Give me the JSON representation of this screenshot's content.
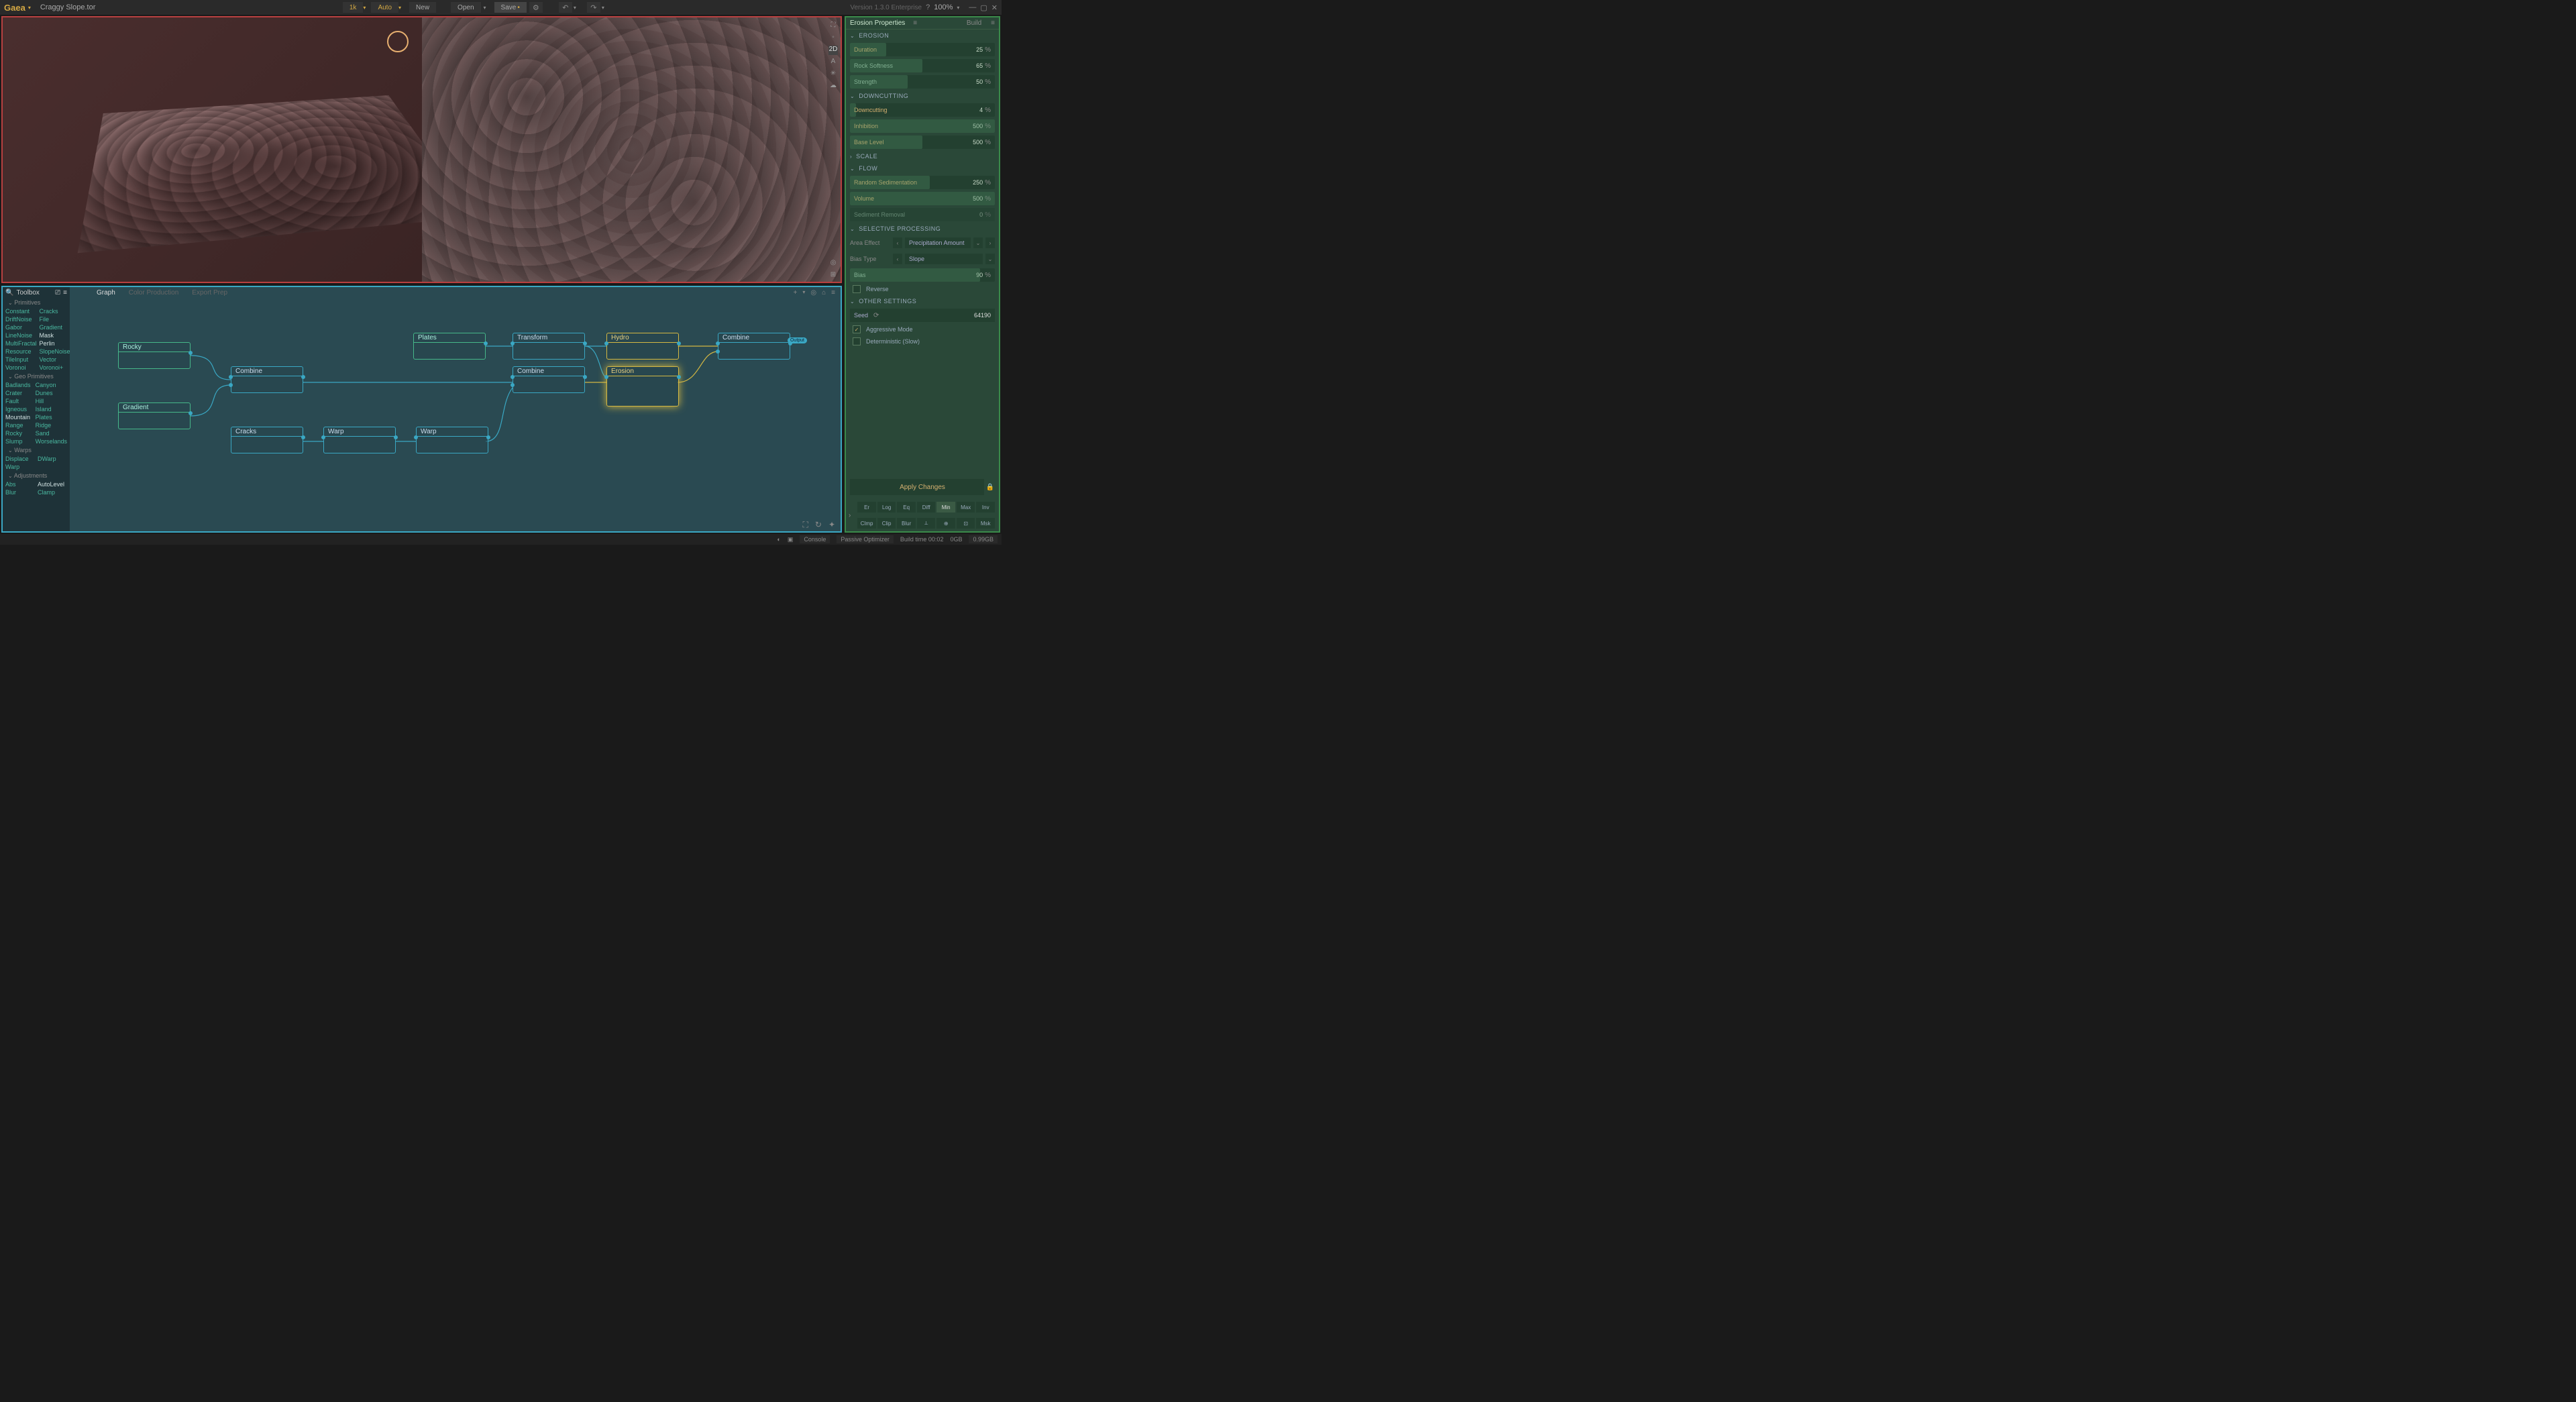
{
  "app": {
    "name": "Gaea",
    "filename": "Craggy Slope.tor",
    "version": "Version 1.3.0 Enterprise",
    "zoom": "100%"
  },
  "topbar": {
    "res": "1k",
    "auto": "Auto",
    "new": "New",
    "open": "Open",
    "save": "Save"
  },
  "viewport": {
    "mode2d": "2D"
  },
  "graph": {
    "toolbox_title": "Toolbox",
    "tabs": {
      "graph": "Graph",
      "color": "Color Production",
      "export": "Export Prep"
    },
    "sections": {
      "primitives": "Primitives",
      "geo": "Geo Primitives",
      "warps": "Warps",
      "adjustments": "Adjustments"
    },
    "primitives": [
      "Constant",
      "Cracks",
      "DriftNoise",
      "File",
      "Gabor",
      "Gradient",
      "LineNoise",
      "Mask",
      "MultiFractal",
      "Perlin",
      "Resource",
      "SlopeNoise",
      "TileInput",
      "Vector",
      "Voronoi",
      "Voronoi+"
    ],
    "geo": [
      "Badlands",
      "Canyon",
      "Crater",
      "Dunes",
      "Fault",
      "Hill",
      "Igneous",
      "Island",
      "Mountain",
      "Plates",
      "Range",
      "Ridge",
      "Rocky",
      "Sand",
      "Slump",
      "Worselands"
    ],
    "warps": [
      "Displace",
      "DWarp",
      "Warp",
      ""
    ],
    "adjustments": [
      "Abs",
      "AutoLevel",
      "Blur",
      "Clamp"
    ],
    "nodes": {
      "rocky": "Rocky",
      "gradient": "Gradient",
      "combine1": "Combine",
      "cracks": "Cracks",
      "warp1": "Warp",
      "warp2": "Warp",
      "plates": "Plates",
      "transform": "Transform",
      "combine2": "Combine",
      "hydro": "Hydro",
      "erosion": "Erosion",
      "combine3": "Combine",
      "output": "Output"
    }
  },
  "props": {
    "title": "Erosion Properties",
    "build": "Build",
    "sections": {
      "erosion": "EROSION",
      "down": "DOWNCUTTING",
      "scale": "SCALE",
      "flow": "FLOW",
      "sel": "SELECTIVE PROCESSING",
      "other": "OTHER SETTINGS"
    },
    "erosion": {
      "duration": {
        "label": "Duration",
        "value": "25",
        "bar": 25
      },
      "rock": {
        "label": "Rock Softness",
        "value": "65",
        "bar": 50
      },
      "strength": {
        "label": "Strength",
        "value": "50",
        "bar": 40
      }
    },
    "down": {
      "downcutting": {
        "label": "Downcutting",
        "value": "4",
        "bar": 4
      },
      "inhibition": {
        "label": "Inhibition",
        "value": "500",
        "bar": 100
      },
      "base": {
        "label": "Base Level",
        "value": "500",
        "bar": 50
      }
    },
    "flow": {
      "sediment": {
        "label": "Random Sedimentation",
        "value": "250",
        "bar": 55
      },
      "volume": {
        "label": "Volume",
        "value": "500",
        "bar": 100
      },
      "removal": {
        "label": "Sediment Removal",
        "value": "0",
        "bar": 0
      }
    },
    "sel": {
      "area_label": "Area Effect",
      "area_value": "Precipitation Amount",
      "bias_type_label": "Bias Type",
      "bias_type_value": "Slope",
      "bias": {
        "label": "Bias",
        "value": "90",
        "bar": 90
      },
      "reverse": "Reverse"
    },
    "other": {
      "seed_label": "Seed",
      "seed_value": "64190",
      "aggressive": "Aggressive Mode",
      "deterministic": "Deterministic (Slow)"
    },
    "apply": "Apply Changes",
    "mini": [
      "Er",
      "Log",
      "Eq",
      "Diff",
      "Min",
      "Max",
      "Inv",
      "Clmp",
      "Clip",
      "Blur",
      "⟂",
      "⊕",
      "⊡",
      "Msk"
    ]
  },
  "status": {
    "console": "Console",
    "optimizer": "Passive Optimizer",
    "build": "Build time 00:02",
    "mem1": "0GB",
    "mem2": "0.99GB"
  }
}
